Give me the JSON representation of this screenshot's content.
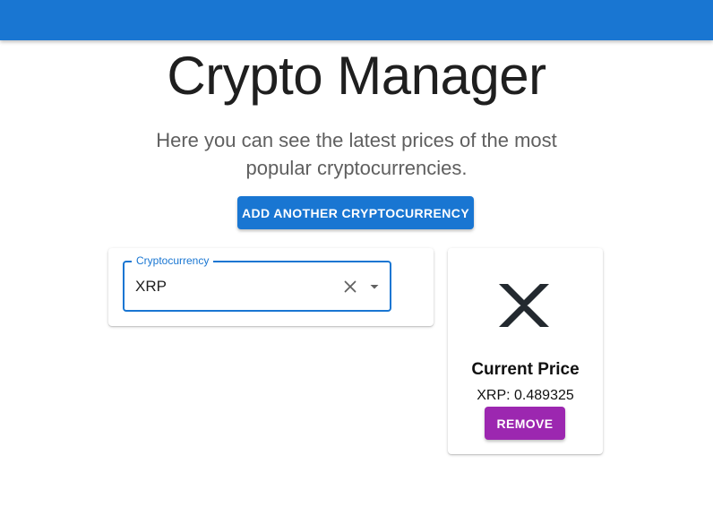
{
  "header": {
    "title": "Crypto Manager",
    "subtitle": "Here you can see the latest prices of the most popular cryptocurrencies."
  },
  "actions": {
    "add_label": "ADD ANOTHER CRYPTOCURRENCY"
  },
  "selector": {
    "label": "Cryptocurrency",
    "value": "XRP",
    "clear_icon": "close-icon",
    "dropdown_icon": "caret-down-icon"
  },
  "price_card": {
    "logo_icon": "xrp-logo-icon",
    "heading": "Current Price",
    "price_text": "XRP: 0.489325",
    "remove_label": "REMOVE"
  },
  "colors": {
    "primary": "#1976d2",
    "secondary": "#9c27b0"
  }
}
